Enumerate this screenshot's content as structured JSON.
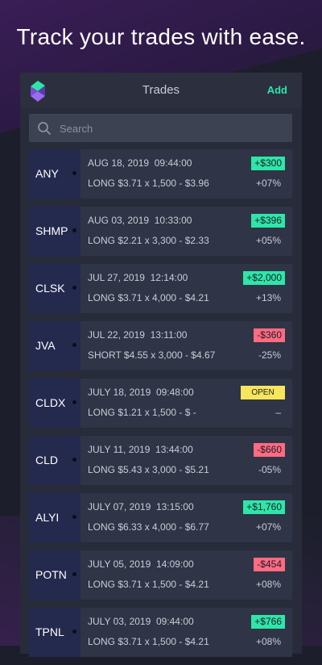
{
  "headline": "Track your trades with ease.",
  "topbar": {
    "title": "Trades",
    "add_label": "Add"
  },
  "search": {
    "placeholder": "Search"
  },
  "colors": {
    "accent_green": "#2ee6a8",
    "loss_red": "#ff6b81",
    "open_yellow": "#f7e65c"
  },
  "trades": [
    {
      "ticker": "ANY",
      "date": "AUG 18, 2019  09:44:00",
      "detail": "LONG $3.71 x 1,500 - $3.96",
      "badge": "+$300",
      "status": "pos",
      "pct": "+07%"
    },
    {
      "ticker": "SHMP",
      "date": "AUG 03, 2019  10:33:00",
      "detail": "LONG $2.21 x 3,300 - $2.33",
      "badge": "+$396",
      "status": "pos",
      "pct": "+05%"
    },
    {
      "ticker": "CLSK",
      "date": "JUL 27, 2019  12:14:00",
      "detail": "LONG $3.71 x 4,000 - $4.21",
      "badge": "+$2,000",
      "status": "pos",
      "pct": "+13%"
    },
    {
      "ticker": "JVA",
      "date": "JUL 22, 2019  13:11:00",
      "detail": "SHORT $4.55 x 3,000 - $4.67",
      "badge": "-$360",
      "status": "neg",
      "pct": "-25%"
    },
    {
      "ticker": "CLDX",
      "date": "JULY 18, 2019  09:48:00",
      "detail": "LONG $1.21 x 1,500 - $ -",
      "badge": "OPEN",
      "status": "open",
      "pct": "–"
    },
    {
      "ticker": "CLD",
      "date": "JULY 11, 2019  13:44:00",
      "detail": "LONG $5.43 x 3,000 - $5.21",
      "badge": "-$660",
      "status": "neg",
      "pct": "-05%"
    },
    {
      "ticker": "ALYI",
      "date": "JULY 07, 2019  13:15:00",
      "detail": "LONG $6.33 x 4,000 - $6.77",
      "badge": "+$1,760",
      "status": "pos",
      "pct": "+07%"
    },
    {
      "ticker": "POTN",
      "date": "JULY 05, 2019  14:09:00",
      "detail": "LONG $3.71 x 1,500 - $4.21",
      "badge": "-$454",
      "status": "neg",
      "pct": "+08%"
    },
    {
      "ticker": "TPNL",
      "date": "JULY 03, 2019  09:44:00",
      "detail": "LONG $3.71 x 1,500 - $4.21",
      "badge": "+$766",
      "status": "pos",
      "pct": "+08%"
    }
  ]
}
